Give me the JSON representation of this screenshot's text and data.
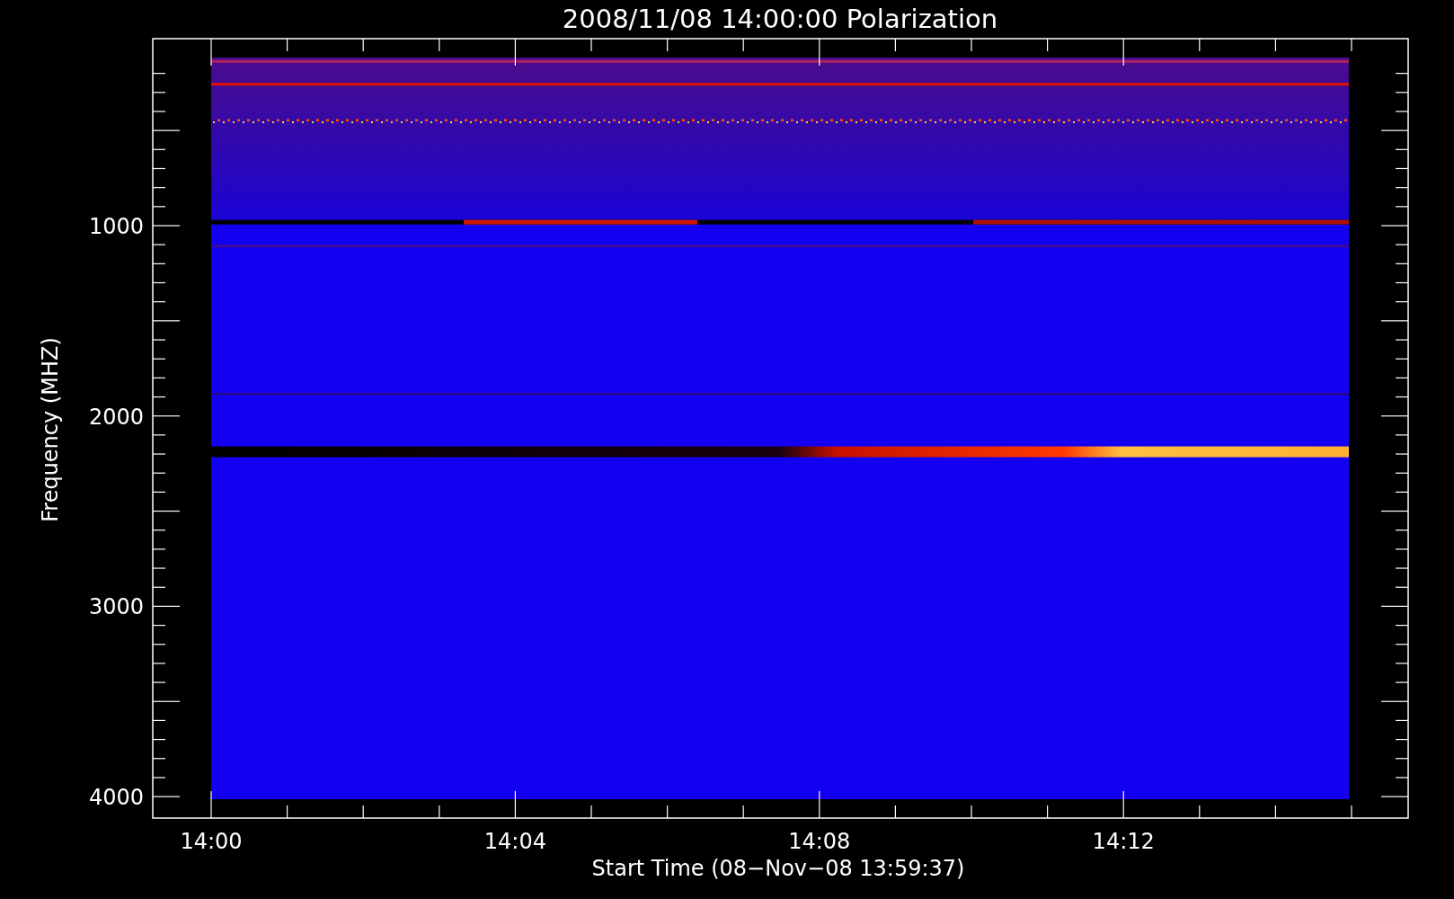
{
  "title": "2008/11/08 14:00:00 Polarization",
  "y_axis": {
    "label": "Frequency (MHZ)",
    "ticks": [
      "1000",
      "2000",
      "3000",
      "4000"
    ]
  },
  "x_axis": {
    "label": "Start Time (08−Nov−08 13:59:37)",
    "ticks": [
      "14:00",
      "14:04",
      "14:08",
      "14:12"
    ]
  }
}
